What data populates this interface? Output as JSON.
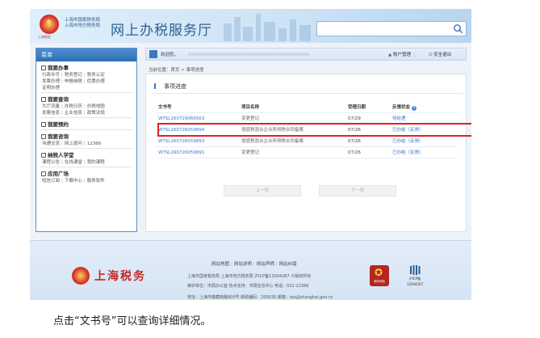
{
  "header": {
    "bureau_line1": "上海市国家税务局",
    "bureau_line2": "上海市地方税务局",
    "sub_caption": "上海税务",
    "site_title": "网上办税服务厅",
    "search_placeholder": ""
  },
  "menu": {
    "title": "菜单",
    "sections": [
      {
        "title": "我要办事",
        "lines": [
          [
            "行政许可",
            "税务登记",
            "税务认定"
          ],
          [
            "发票办理",
            "申报纳税",
            "优惠办理"
          ],
          [
            "证明办理"
          ]
        ]
      },
      {
        "title": "我要查询",
        "lines": [
          [
            "大厅流量",
            "办税日历",
            "办税地图"
          ],
          [
            "发票信息",
            "企业信息",
            "政策法规"
          ]
        ]
      },
      {
        "title": "我要预约",
        "lines": []
      },
      {
        "title": "我要咨询",
        "lines": [
          [
            "沟通交流",
            "网上提问",
            "12366"
          ]
        ]
      },
      {
        "title": "纳税人学堂",
        "lines": [
          [
            "课程公告",
            "在线课堂",
            "我的课程"
          ]
        ]
      },
      {
        "title": "应用广场",
        "lines": [
          [
            "短信订阅",
            "下载中心",
            "服务软件"
          ]
        ]
      }
    ]
  },
  "welcome": {
    "text": "欢迎您，",
    "account_mgmt": "账户管理",
    "safe_exit": "安全退出"
  },
  "breadcrumb": "当前位置：首页 > 事项进度",
  "panel": {
    "title": "事项进度",
    "columns": [
      "文书号",
      "项目名称",
      "受理日期",
      "反馈状态"
    ],
    "rows": [
      {
        "doc": "WTSL160729060563",
        "name": "变更登记",
        "date": "07/29",
        "status": "待处理",
        "extra": ""
      },
      {
        "doc": "WTSL160726059894",
        "name": "增值税混合企业所得税合同备案",
        "date": "07/26",
        "status": "已办结",
        "extra": "（反馈）"
      },
      {
        "doc": "WTSL160726059893",
        "name": "增值税混合企业所得税合同备案",
        "date": "07/26",
        "status": "已办结",
        "extra": "（反馈）"
      },
      {
        "doc": "WTSL160726059891",
        "name": "变更登记",
        "date": "07/26",
        "status": "已办结",
        "extra": "（反馈）"
      }
    ],
    "prev_label": "上一页",
    "next_label": "下一页"
  },
  "footer": {
    "links": [
      "网站地图",
      "网站说明",
      "网站声明",
      "网站纠错"
    ],
    "logo_text": "上海税务",
    "line1": "上海市国家税务局 上海市地方税务局 沪ICP备12004267 ©版权所有",
    "line2": "维护单位：市局办公室   技术支持：市局信息中心   电话：021-12366",
    "line3": "地址：上海市徽藏南路800号   邮政编码：200030   邮箱：tax@shanghai.gov.cn",
    "badge1_label": "我的网站",
    "badge2_l1": "沪ICP备",
    "badge2_l2": "12004267"
  },
  "caption": "点击“文书号”可以查询详细情况。",
  "colors": {
    "accent_blue": "#2e6fb5",
    "link_blue": "#3a77c3",
    "highlight_red": "#d7232b",
    "logo_red": "#c22a22"
  }
}
